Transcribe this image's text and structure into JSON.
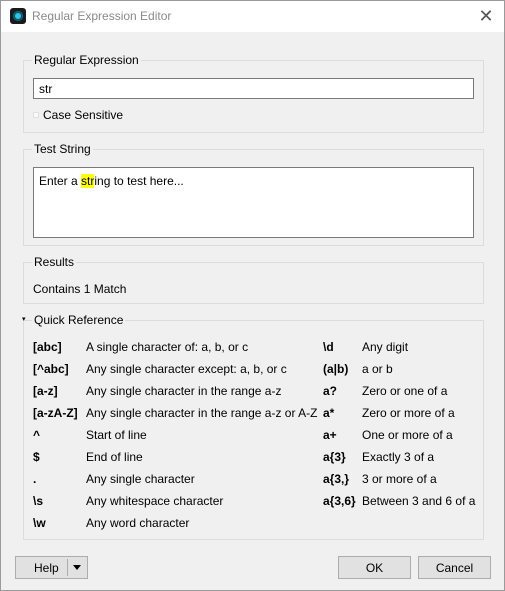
{
  "window": {
    "title": "Regular Expression Editor",
    "close_glyph": "✕"
  },
  "regex_group": {
    "label": "Regular Expression",
    "value": "str",
    "case_sensitive_label": "Case Sensitive",
    "case_sensitive_checked": false
  },
  "test_group": {
    "label": "Test String",
    "text_before": "Enter a ",
    "text_match": "str",
    "text_after": "ing to test here..."
  },
  "results_group": {
    "label": "Results",
    "text": "Contains 1 Match"
  },
  "quick_reference": {
    "label": "Quick Reference",
    "left": [
      {
        "code": "[abc]",
        "desc": "A single character of: a, b, or c"
      },
      {
        "code": "[^abc]",
        "desc": "Any single character except: a, b, or c"
      },
      {
        "code": "[a-z]",
        "desc": "Any single character in the range a-z"
      },
      {
        "code": "[a-zA-Z]",
        "desc": "Any single character in the range a-z or A-Z"
      },
      {
        "code": "^",
        "desc": "Start of line"
      },
      {
        "code": "$",
        "desc": "End of line"
      },
      {
        "code": ".",
        "desc": "Any single character"
      },
      {
        "code": "\\s",
        "desc": "Any whitespace character"
      },
      {
        "code": "\\w",
        "desc": "Any word character"
      }
    ],
    "right": [
      {
        "code": "\\d",
        "desc": "Any digit"
      },
      {
        "code": "(a|b)",
        "desc": "a or b"
      },
      {
        "code": "a?",
        "desc": "Zero or one of a"
      },
      {
        "code": "a*",
        "desc": "Zero or more of a"
      },
      {
        "code": "a+",
        "desc": "One or more of a"
      },
      {
        "code": "a{3}",
        "desc": "Exactly 3 of a"
      },
      {
        "code": "a{3,}",
        "desc": "3 or more of a"
      },
      {
        "code": "a{3,6}",
        "desc": "Between 3 and 6 of a"
      }
    ]
  },
  "buttons": {
    "help": "Help",
    "ok": "OK",
    "cancel": "Cancel"
  },
  "colors": {
    "highlight": "#ffff00",
    "window_bg": "#f0f0f0"
  }
}
